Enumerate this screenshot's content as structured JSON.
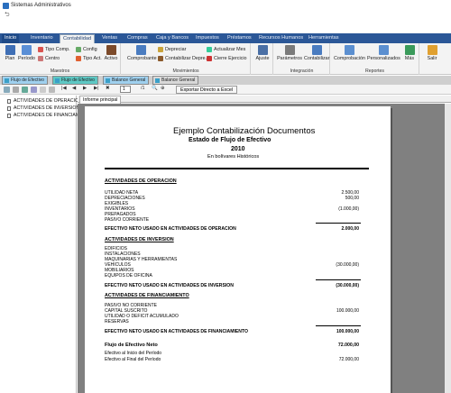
{
  "window": {
    "title": "Sistemas Administrativos"
  },
  "ribbon_tabs": [
    "Inicio",
    "Inventario",
    "Contabilidad",
    "Ventas",
    "Compras",
    "Caja y Bancos",
    "Impuestos",
    "Préstamos",
    "Recursos Humanos",
    "Herramientas"
  ],
  "active_tab": "Contabilidad",
  "ribbon": {
    "maestros": {
      "label": "Maestros",
      "plan": "Plan",
      "periodo": "Período",
      "tipo_comp": "Tipo Comp.",
      "centro": "Centro",
      "config": "Config",
      "tipo_act": "Tipo Act.",
      "activo": "Activo"
    },
    "movimientos": {
      "label": "Movimientos",
      "comprobante": "Comprobante",
      "depreciar": "Depreciar",
      "contabilizar_depre": "Contabilizar Depre.",
      "actualizar_mes": "Actualizar Mes",
      "cierre_ejercicio": "Cierre Ejercicio"
    },
    "ajuste": {
      "label": "Ajuste"
    },
    "integracion": {
      "label": "Integración",
      "parametros": "Parámetros",
      "contabilizar": "Contabilizar"
    },
    "reportes": {
      "label": "Reportes",
      "comprobacion": "Comprobación",
      "personalizados": "Personalizados",
      "mas": "Más"
    },
    "salir": "Salir"
  },
  "doc_tabs": [
    "Flujo de Efectivo",
    "Flujo de Efectivo",
    "Balance General",
    "Balance General"
  ],
  "toolbar": {
    "page_number": "1",
    "page_total": "/1",
    "export_label": "Exportar Directo a Excel"
  },
  "tree": [
    "ACTIVIDADES DE OPERACION",
    "ACTIVIDADES DE INVERSION",
    "ACTIVIDADES DE FINANCIAMIENTO"
  ],
  "report_tab": "Informe principal",
  "report": {
    "company": "Ejemplo Contabilización Documentos",
    "title": "Estado de Flujo de Efectivo",
    "year": "2010",
    "currency": "En bolívares Históricos",
    "operacion": {
      "heading": "ACTIVIDADES DE OPERACION",
      "items": [
        {
          "label": "UTILIDAD NETA",
          "value": "2.500,00"
        },
        {
          "label": "DEPRECIACIONES",
          "value": "500,00"
        },
        {
          "label": "EXIGIBLES",
          "value": ""
        },
        {
          "label": "INVENTARIOS",
          "value": "(1.000,00)"
        },
        {
          "label": "PREPAGADOS",
          "value": ""
        },
        {
          "label": "PASIVO CORRIENTE",
          "value": ""
        }
      ],
      "total_label": "EFECTIVO NETO USADO EN ACTIVIDADES DE OPERACION",
      "total_value": "2.000,00"
    },
    "inversion": {
      "heading": "ACTIVIDADES DE INVERSION",
      "items": [
        {
          "label": "EDIFICIOS",
          "value": ""
        },
        {
          "label": "INSTALACIONES",
          "value": ""
        },
        {
          "label": "MAQUINARIAS Y HERRAMIENTAS",
          "value": ""
        },
        {
          "label": "VEHICULOS",
          "value": "(30.000,00)"
        },
        {
          "label": "MOBILIARIOS",
          "value": ""
        },
        {
          "label": "EQUIPOS DE OFICINA",
          "value": ""
        }
      ],
      "total_label": "EFECTIVO NETO USADO EN ACTIVIDADES DE INVERSION",
      "total_value": "(30.000,00)"
    },
    "financiamiento": {
      "heading": "ACTIVIDADES DE FINANCIAMIENTO",
      "items": [
        {
          "label": "PASIVO NO CORRIENTE",
          "value": ""
        },
        {
          "label": "CAPITAL SUSCRITO",
          "value": "100.000,00"
        },
        {
          "label": "UTILIDAD O DEFICIT ACUMULADO",
          "value": ""
        },
        {
          "label": "RESERVAS",
          "value": ""
        }
      ],
      "total_label": "EFECTIVO NETO USADO EN ACTIVIDADES DE FINANCIAMIENTO",
      "total_value": "100.000,00"
    },
    "flujo_neto_label": "Flujo de Efectivo Neto",
    "flujo_neto_value": "72.000,00",
    "inicio_label": "Efectivo al Inicio del Período",
    "inicio_value": "",
    "final_label": "Efectivo al Final del Período",
    "final_value": "72.000,00"
  }
}
